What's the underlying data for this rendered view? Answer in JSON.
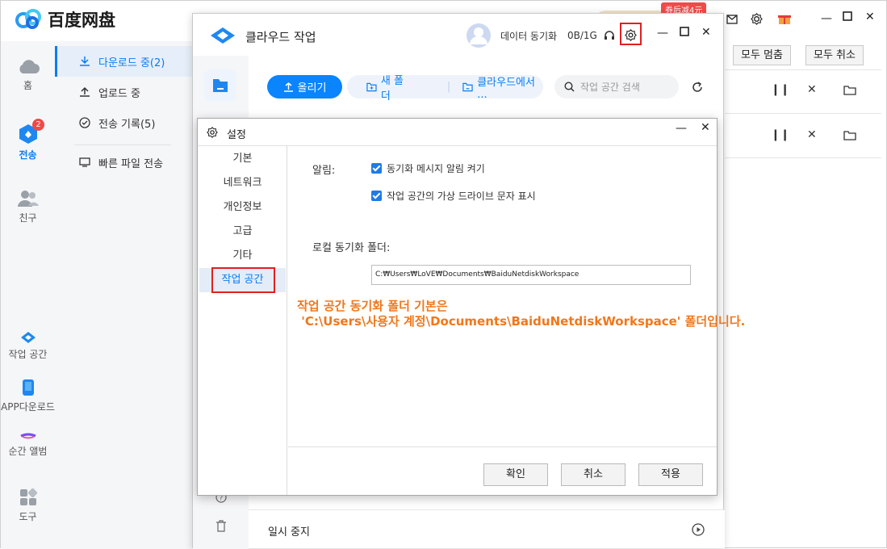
{
  "app": {
    "logo_text": "百度网盘",
    "promo_badge": "券后减4元"
  },
  "rail": {
    "home": "홈",
    "transfer": "전송",
    "transfer_badge": "2",
    "friends": "친구",
    "workspace": "작업 공간",
    "app_download": "APP다운로드",
    "moment_album": "순간 앨범",
    "tools": "도구"
  },
  "transfer_menu": {
    "downloading": "다운로드 중(2)",
    "uploading": "업로드 중",
    "history": "전송 기록(5)",
    "quick_send": "빠른 파일 전송"
  },
  "toolbar": {
    "pause_all": "모두 멈춤",
    "cancel_all": "모두 취소"
  },
  "cloud_window": {
    "title": "클라우드 작업",
    "sync_label": "데이터 동기화",
    "usage": "0B/1G",
    "upload_btn": "올리기",
    "new_folder_btn": "새 폴더",
    "from_cloud_btn": "클라우드에서 ...",
    "search_placeholder": "작업 공간 검색",
    "paused_label": "일시 중지"
  },
  "settings": {
    "title": "설정",
    "nav": [
      "기본",
      "네트워크",
      "개인정보",
      "고급",
      "기타",
      "작업 공간"
    ],
    "notice_label": "알림:",
    "option_sync_notify": "동기화 메시지 알림 켜기",
    "option_drive_letter": "작업 공간의 가상 드라이브 문자 표시",
    "local_folder_label": "로컬 동기화 폴더:",
    "local_folder_path": "C:₩Users₩LoVE₩Documents₩BaiduNetdiskWorkspace",
    "confirm": "확인",
    "cancel": "취소",
    "apply": "적용"
  },
  "annotation": {
    "line1": "작업 공간 동기화 폴더 기본은",
    "line2": " 'C:\\Users\\사용자 계정\\Documents\\BaiduNetdiskWorkspace' 폴더입니다."
  },
  "colors": {
    "accent": "#0a84ff",
    "highlight_box": "#e02020",
    "annotation": "#f0771c"
  }
}
